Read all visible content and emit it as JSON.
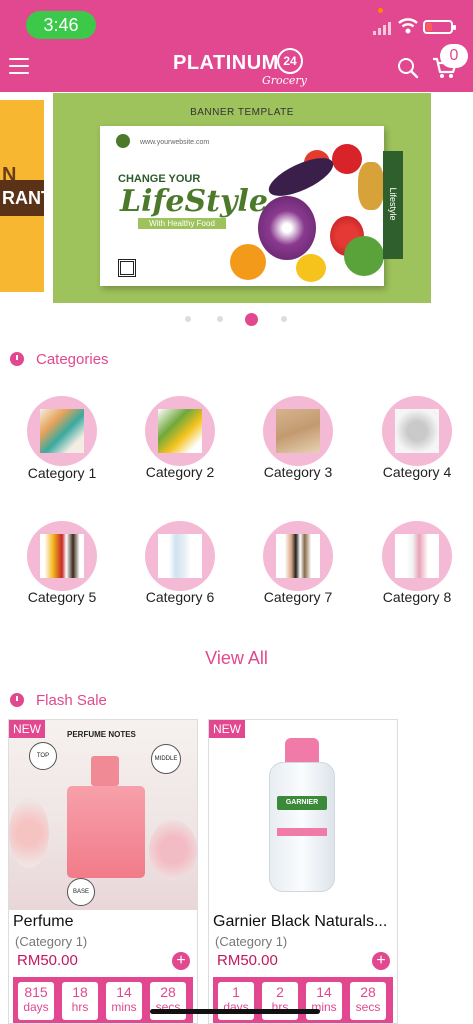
{
  "status_bar": {
    "time": "3:46",
    "battery_color": "#ff5a5a"
  },
  "header": {
    "brand": "PLATINUM",
    "brand_num": "24",
    "brand_sub": "Grocery",
    "cart_count": "0",
    "bg_color": "#e2488f"
  },
  "banner": {
    "title": "BANNER TEMPLATE",
    "site": "www.yourwebsite.com",
    "headline": "CHANGE YOUR",
    "script": "LifeStyle",
    "tagline": "With Healthy Food",
    "side": "Lifestyle",
    "left_partial_1": "N",
    "left_partial_2": "RANT",
    "pager_active": 3,
    "pager_total": 4
  },
  "categories": {
    "heading": "Categories",
    "items": [
      {
        "label": "Category 1"
      },
      {
        "label": "Category 2"
      },
      {
        "label": "Category 3"
      },
      {
        "label": "Category 4"
      },
      {
        "label": "Category 5"
      },
      {
        "label": "Category 6"
      },
      {
        "label": "Category 7"
      },
      {
        "label": "Category 8"
      }
    ],
    "view_all": "View All"
  },
  "flash_sale": {
    "heading": "Flash Sale",
    "products": [
      {
        "tag": "NEW",
        "name": "Perfume",
        "category": "(Category 1)",
        "price": "RM50.00",
        "image_title": "PERFUME NOTES",
        "notes_top": "TOP",
        "notes_middle": "MIDDLE",
        "notes_base": "BASE",
        "timer": [
          {
            "n": "815",
            "u": "days"
          },
          {
            "n": "18",
            "u": "hrs"
          },
          {
            "n": "14",
            "u": "mins"
          },
          {
            "n": "28",
            "u": "secs"
          }
        ]
      },
      {
        "tag": "NEW",
        "name": "Garnier Black Naturals...",
        "category": "(Category 1)",
        "price": "RM50.00",
        "bottle_brand": "GARNIER",
        "timer": [
          {
            "n": "1",
            "u": "days"
          },
          {
            "n": "2",
            "u": "hrs"
          },
          {
            "n": "14",
            "u": "mins"
          },
          {
            "n": "28",
            "u": "secs"
          }
        ]
      }
    ]
  }
}
